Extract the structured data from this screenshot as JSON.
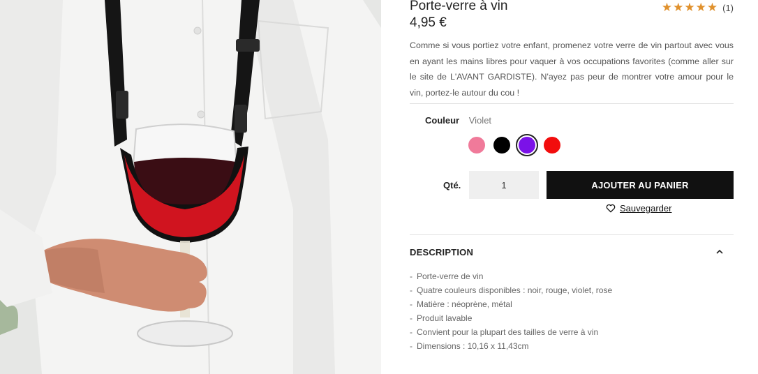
{
  "product": {
    "title": "Porte-verre à vin",
    "rating_count": "(1)",
    "stars": [
      "★",
      "★",
      "★",
      "★",
      "★"
    ],
    "price": "4,95 €",
    "description": "Comme si vous portiez votre enfant, promenez votre verre de vin partout avec vous en ayant les mains libres pour vaquer à vos occupations favorites (comme aller sur le site de L'AVANT GARDISTE). N'ayez pas peur de montrer votre amour pour le vin, portez-le autour du cou !"
  },
  "options": {
    "color_label": "Couleur",
    "color_value": "Violet",
    "swatches": [
      {
        "name": "rose",
        "color": "#f07a9a"
      },
      {
        "name": "noir",
        "color": "#000000"
      },
      {
        "name": "violet",
        "color": "#7b12e8",
        "selected": true
      },
      {
        "name": "rouge",
        "color": "#f20d0d"
      }
    ]
  },
  "cart": {
    "qty_label": "Qté.",
    "qty_value": "1",
    "add_label": "AJOUTER AU PANIER",
    "save_label": "Sauvegarder"
  },
  "details": {
    "section_title": "DESCRIPTION",
    "dash": "-",
    "bullets": [
      "Porte-verre de vin",
      "Quatre couleurs disponibles : noir, rouge, violet, rose",
      "Matière : néoprène, métal",
      "Produit lavable",
      "Convient pour la plupart des tailles de verre à vin",
      "Dimensions : 10,16 x 11,43cm"
    ]
  },
  "colors": {
    "accent_star": "#e0912d",
    "button_bg": "#111111"
  }
}
